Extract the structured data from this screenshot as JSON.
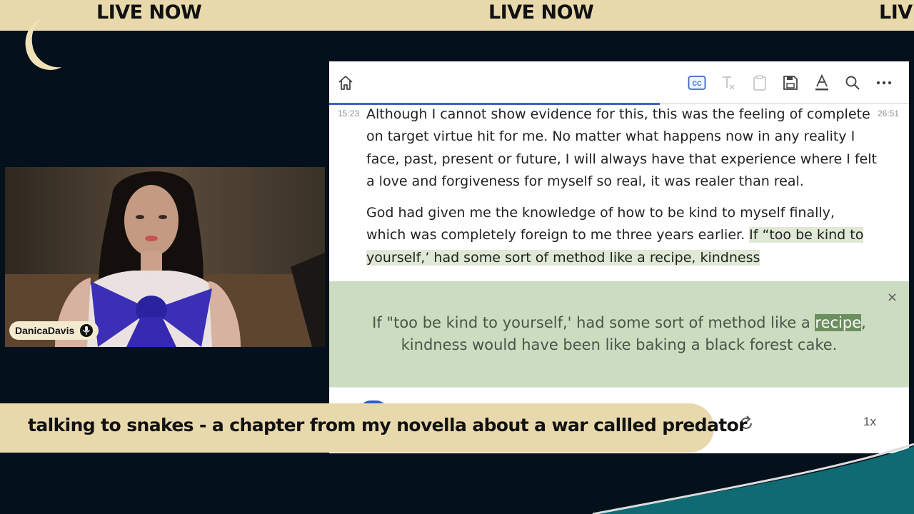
{
  "ticker": {
    "items": [
      "LIVE NOW",
      "LIVE NOW",
      "LIVE NOW"
    ]
  },
  "webcam": {
    "name": "DanicaDavis",
    "mic_icon": "microphone-icon"
  },
  "reader": {
    "toolbar": {
      "icons": [
        "home-icon",
        "captions-icon",
        "clear-format-icon",
        "clipboard-icon",
        "save-icon",
        "text-color-icon",
        "search-icon",
        "more-icon"
      ],
      "captions_label": "CC"
    },
    "progress_percent": 57,
    "time_elapsed": "15:23",
    "time_total": "26:51",
    "paragraph1": "Although I cannot show evidence for this, this was the feeling of complete on target virtue hit for me.  No matter what happens now in any reality I face, past, present or future, I will always have that experience where I felt a love and forgiveness for myself so real, it was realer than real.",
    "paragraph2_plain": "God had given me the knowledge of how to be kind to myself finally, which was completely foreign to me three years earlier. ",
    "paragraph2_highlight": "If “too be kind to yourself,’ had some sort of method like a recipe, kindness",
    "popup": {
      "close_label": "×",
      "before": "If \"too be kind to yourself,' had some sort of method like a ",
      "word": "recipe",
      "after": ", kindness would have been like baking a black forest cake."
    },
    "speed_label": "1x",
    "accent_color": "#3c66c4"
  },
  "lower_third": {
    "title": "talking to snakes - a chapter from my novella about a war callled predator"
  },
  "colors": {
    "background": "#04111c",
    "banner": "#e8d9ad",
    "wave": "#0f6a73",
    "highlight": "#cbdcc1"
  }
}
